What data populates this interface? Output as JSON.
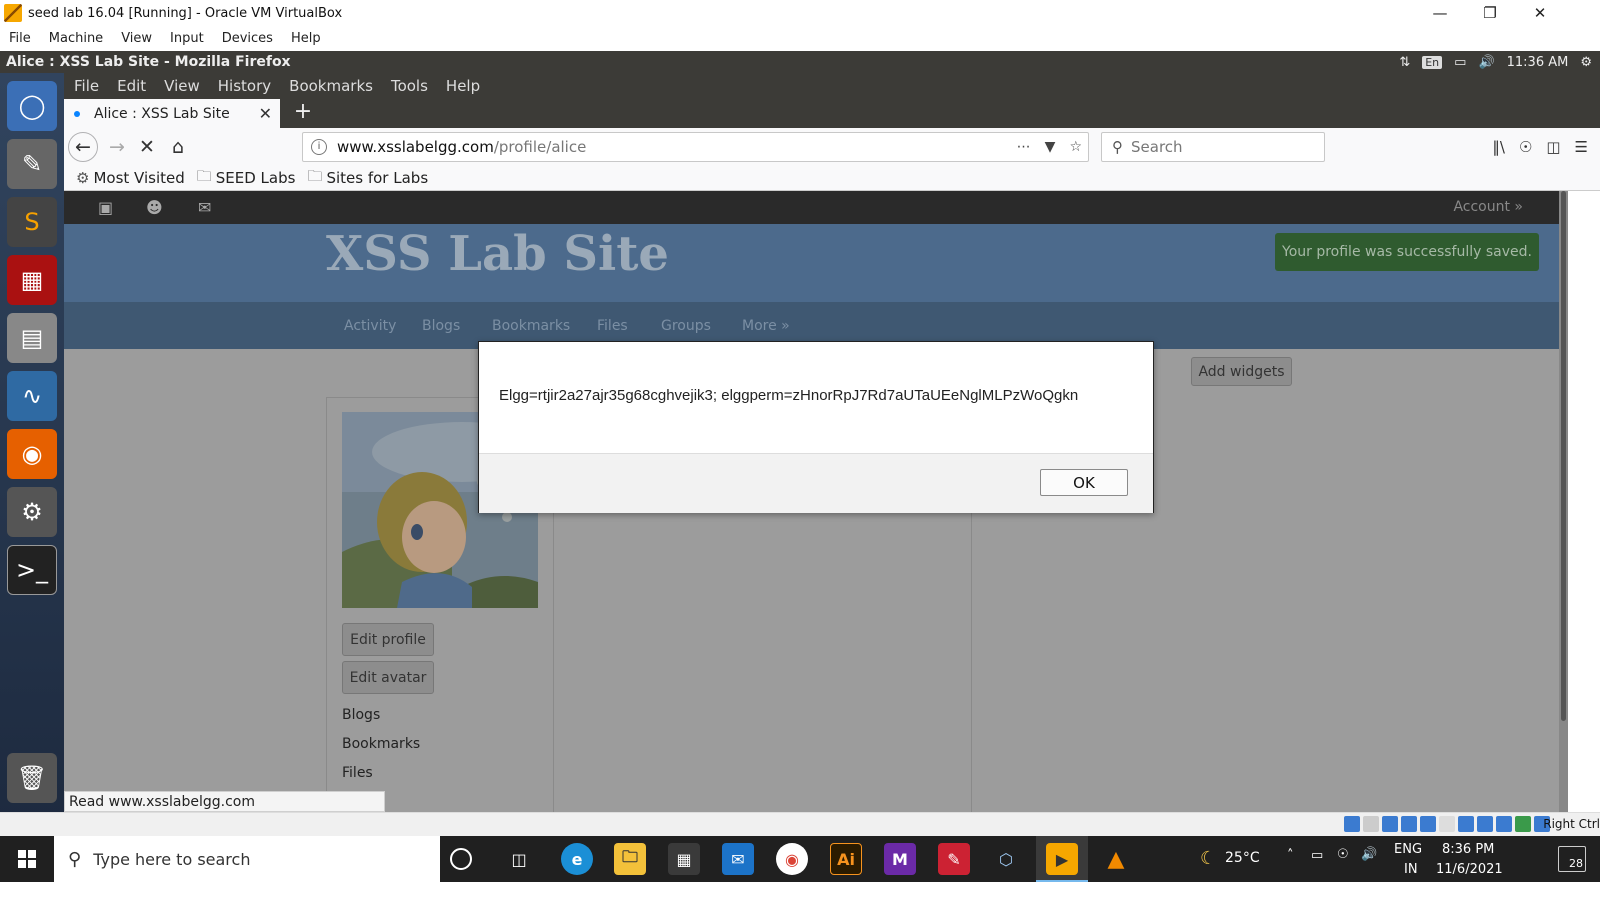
{
  "vb": {
    "title": "seed lab 16.04 [Running] - Oracle VM VirtualBox",
    "menu": [
      "File",
      "Machine",
      "View",
      "Input",
      "Devices",
      "Help"
    ],
    "host_key": "Right Ctrl"
  },
  "ubuntu": {
    "window_title": "Alice : XSS Lab Site - Mozilla Firefox",
    "lang": "En",
    "time": "11:36 AM"
  },
  "firefox": {
    "menu": [
      "File",
      "Edit",
      "View",
      "History",
      "Bookmarks",
      "Tools",
      "Help"
    ],
    "tab_title": "Alice : XSS Lab Site",
    "url_host": "www.xsslabelgg.com",
    "url_path": "/profile/alice",
    "search_placeholder": "Search",
    "bookmarks": [
      "Most Visited",
      "SEED Labs",
      "Sites for Labs"
    ],
    "status_text": "Read www.xsslabelgg.com"
  },
  "site": {
    "title": "XSS Lab Site",
    "account": "Account »",
    "saved_message": "Your profile was successfully saved.",
    "nav": [
      "Activity",
      "Blogs",
      "Bookmarks",
      "Files",
      "Groups",
      "More »"
    ],
    "add_widgets": "Add widgets",
    "edit_profile": "Edit profile",
    "edit_avatar": "Edit avatar",
    "side_links": [
      "Blogs",
      "Bookmarks",
      "Files"
    ]
  },
  "alert": {
    "message": "Elgg=rtjir2a27ajr35g68cghvejik3; elggperm=zHnorRpJ7Rd7aUTaUEeNglMLPzWoQgkn",
    "ok_label": "OK"
  },
  "taskbar": {
    "search_placeholder": "Type here to search",
    "weather": "25°C",
    "lang_top": "ENG",
    "lang_bottom": "IN",
    "time": "8:36 PM",
    "date": "11/6/2021",
    "notifications": "28"
  }
}
